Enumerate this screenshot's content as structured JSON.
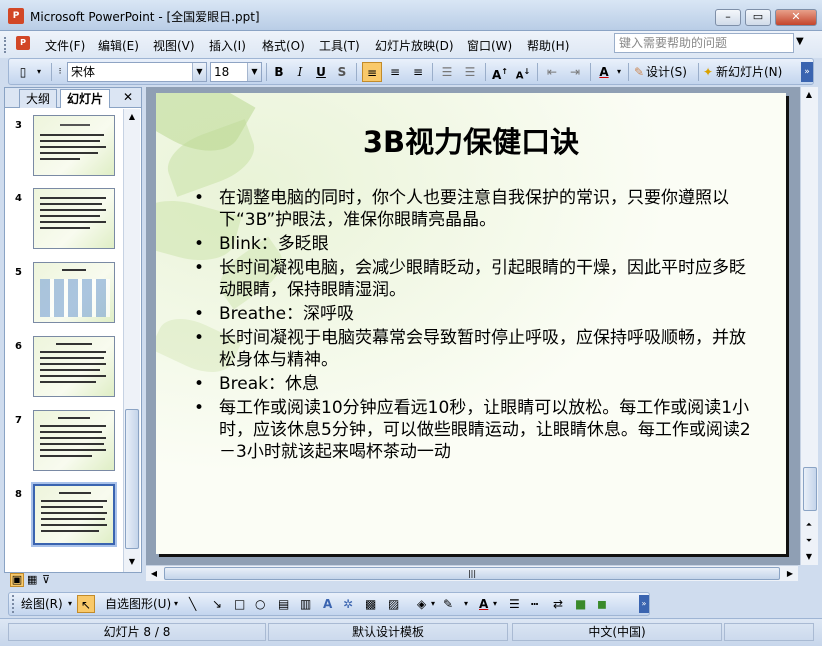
{
  "window": {
    "title": "Microsoft PowerPoint - [全国爱眼日.ppt]",
    "app_icon": "powerpoint-icon"
  },
  "menu": {
    "items": [
      "文件(F)",
      "编辑(E)",
      "视图(V)",
      "插入(I)",
      "格式(O)",
      "工具(T)",
      "幻灯片放映(D)",
      "窗口(W)",
      "帮助(H)"
    ],
    "help_placeholder": "键入需要帮助的问题"
  },
  "toolbar": {
    "font_name": "宋体",
    "font_size": "18",
    "bold": "B",
    "italic": "I",
    "underline": "U",
    "shadow": "S",
    "font_color_label": "A",
    "design_label": "设计(S)",
    "new_slide_label": "新幻灯片(N)"
  },
  "pane": {
    "tab_outline": "大纲",
    "tab_slides": "幻灯片",
    "close": "✕",
    "thumb_numbers": [
      "3",
      "4",
      "5",
      "6",
      "7",
      "8"
    ],
    "selected_slide": "8"
  },
  "slide": {
    "title": "3B视力保健口诀",
    "bullets": [
      "在调整电脑的同时，你个人也要注意自我保护的常识，只要你遵照以下“3B”护眼法，准保你眼睛亮晶晶。",
      "Blink：多眨眼",
      "长时间凝视电脑，会减少眼睛眨动，引起眼睛的干燥，因此平时应多眨动眼睛，保持眼睛湿润。",
      "Breathe：深呼吸",
      "长时间凝视于电脑荧幕常会导致暂时停止呼吸，应保持呼吸顺畅，并放松身体与精神。",
      "Break：休息",
      "每工作或阅读10分钟应看远10秒，让眼睛可以放松。每工作或阅读1小时，应该休息5分钟，可以做些眼睛运动，让眼睛休息。每工作或阅读2－3小时就该起来喝杯茶动一动"
    ]
  },
  "drawing": {
    "draw_label": "绘图(R)",
    "autoshapes_label": "自选图形(U)"
  },
  "status": {
    "slide_info": "幻灯片 8 / 8",
    "template": "默认设计模板",
    "language": "中文(中国)"
  },
  "colors": {
    "accent": "#3a64b0",
    "title_bar": "#b9cde6",
    "slide_bg": "#fbfdf5"
  }
}
